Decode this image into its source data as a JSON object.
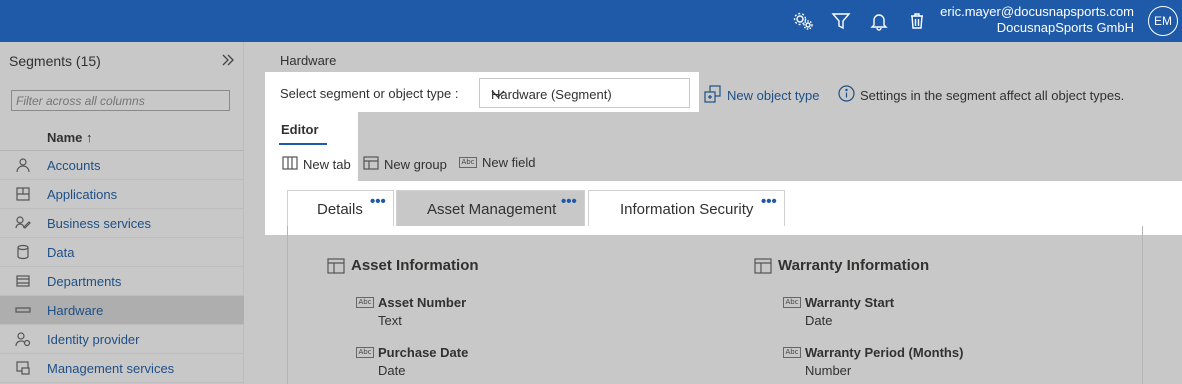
{
  "topbar": {
    "user_email": "eric.mayer@docusnapsports.com",
    "company": "DocusnapSports GmbH",
    "avatar_initials": "EM",
    "icons": [
      "settings-icon",
      "filter-icon",
      "bell-icon",
      "trash-icon"
    ]
  },
  "sidebar": {
    "title": "Segments (15)",
    "filter_placeholder": "Filter across all columns",
    "column_header": "Name ↑",
    "items": [
      {
        "label": "Accounts",
        "icon": "user-icon"
      },
      {
        "label": "Applications",
        "icon": "applications-icon"
      },
      {
        "label": "Business services",
        "icon": "business-services-icon"
      },
      {
        "label": "Data",
        "icon": "database-icon"
      },
      {
        "label": "Departments",
        "icon": "departments-icon"
      },
      {
        "label": "Hardware",
        "icon": "hardware-icon",
        "active": true
      },
      {
        "label": "Identity provider",
        "icon": "identity-provider-icon"
      },
      {
        "label": "Management services",
        "icon": "management-services-icon"
      }
    ]
  },
  "main": {
    "breadcrumb": "Hardware",
    "select_label": "Select segment or object type :",
    "select_value": "Hardware (Segment)",
    "new_object_type": "New object type",
    "info_text": "Settings in the segment affect all object types.",
    "editor_tab": "Editor",
    "toolbar": {
      "new_tab": "New tab",
      "new_group": "New group",
      "new_field": "New field"
    },
    "tabs": [
      {
        "label": "Details",
        "dots": "•••"
      },
      {
        "label": "Asset Management",
        "dots": "•••",
        "active": true
      },
      {
        "label": "Information Security",
        "dots": "•••"
      }
    ],
    "groups": [
      {
        "title": "Asset Information",
        "fields": [
          {
            "name": "Asset Number",
            "type": "Text"
          },
          {
            "name": "Purchase Date",
            "type": "Date"
          }
        ]
      },
      {
        "title": "Warranty Information",
        "fields": [
          {
            "name": "Warranty Start",
            "type": "Date"
          },
          {
            "name": "Warranty Period (Months)",
            "type": "Number"
          }
        ]
      }
    ],
    "field_icon_text": "Abc"
  }
}
